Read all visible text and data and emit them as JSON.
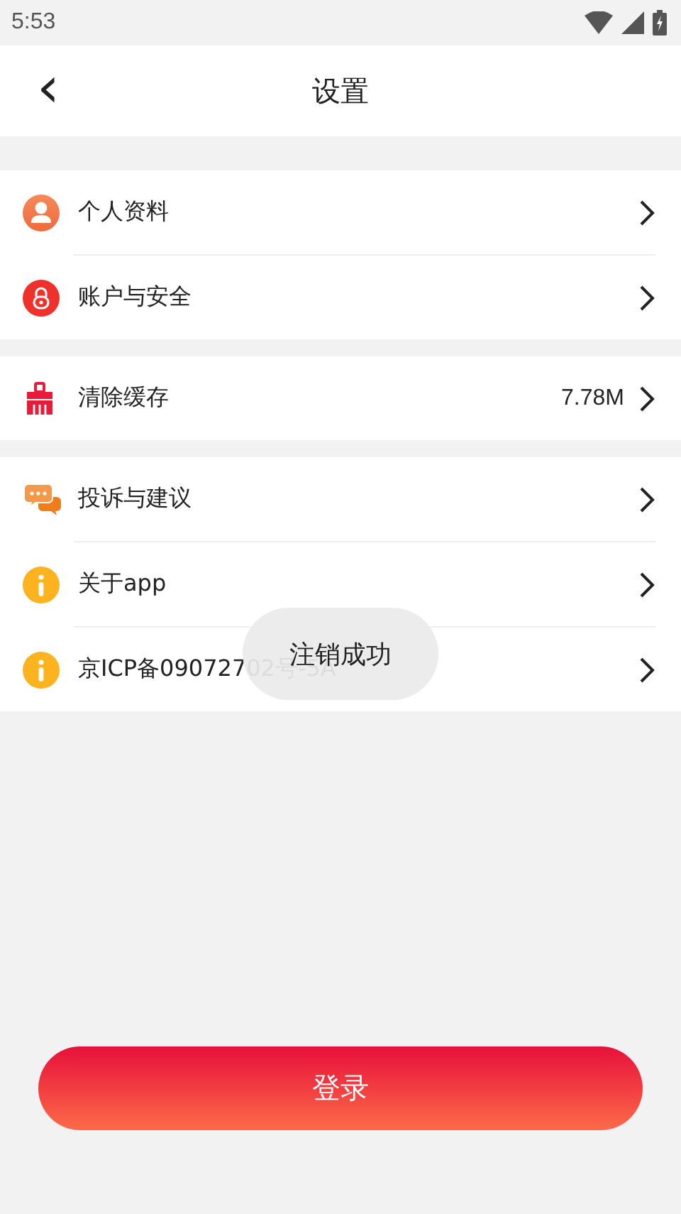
{
  "status_bar": {
    "time": "5:53"
  },
  "header": {
    "back": "‹",
    "title": "设置"
  },
  "groups": [
    {
      "items": [
        {
          "kind": "person",
          "label": "个人资料"
        },
        {
          "kind": "lock",
          "label": "账户与安全"
        }
      ]
    },
    {
      "items": [
        {
          "kind": "brush",
          "label": "清除缓存",
          "value": "7.78M"
        }
      ]
    },
    {
      "items": [
        {
          "kind": "chat",
          "label": "投诉与建议"
        },
        {
          "kind": "info",
          "label": "关于app"
        },
        {
          "kind": "info",
          "label": "京ICP备09072702号-5A"
        }
      ]
    }
  ],
  "toast": "注销成功",
  "login_button": "登录"
}
